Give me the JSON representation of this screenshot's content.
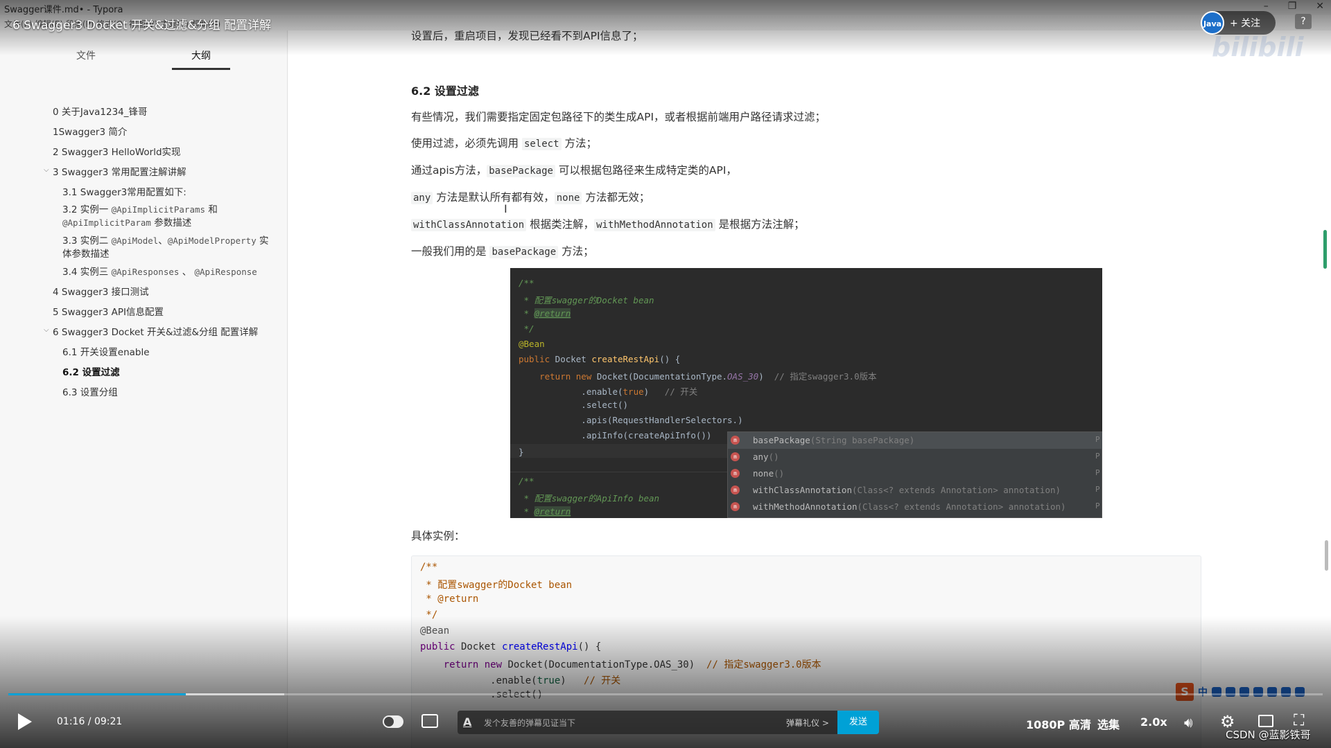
{
  "window": {
    "app_title": "Swagger课件.md• - Typora",
    "menu_stub": "文件(F)  编辑(E)  段落(P)  格式(O)  视图(V)  主题(T)  帮助(H)"
  },
  "sidebar": {
    "tab_files": "文件",
    "tab_outline": "大纲",
    "items": [
      {
        "label": "0 关于Java1234_锋哥"
      },
      {
        "label": "1Swagger3 简介"
      },
      {
        "label": "2 Swagger3 HelloWorld实现"
      },
      {
        "label": "3 Swagger3 常用配置注解讲解"
      },
      {
        "label": "3.1 Swagger3常用配置如下:"
      },
      {
        "label_a": "3.2 实例一 ",
        "code_a": "@ApiImplicitParams",
        "label_b": " 和",
        "code_b": "@ApiImplicitParam",
        "label_c": " 参数描述"
      },
      {
        "label_a": "3.3 实例二 ",
        "code_a": "@ApiModel",
        "label_b": "、",
        "code_b": "@ApiModelProperty",
        "label_c": " 实",
        "label_d": "体参数描述"
      },
      {
        "label_a": "3.4 实例三 ",
        "code_a": "@ApiResponses",
        "label_b": " 、 ",
        "code_b": "@ApiResponse"
      },
      {
        "label": "4 Swagger3 接口测试"
      },
      {
        "label": "5 Swagger3 API信息配置"
      },
      {
        "label": "6 Swagger3 Docket 开关&过滤&分组 配置详解"
      },
      {
        "label": "6.1 开关设置enable"
      },
      {
        "label": "6.2 设置过滤"
      },
      {
        "label": "6.3 设置分组"
      }
    ]
  },
  "content": {
    "p1": "设置后，重启项目，发现已经看不到API信息了；",
    "h3": "6.2 设置过滤",
    "p2": "有些情况，我们需要指定固定包路径下的类生成API，或者根据前端用户路径请求过滤；",
    "p3_a": "使用过滤，必须先调用 ",
    "p3_code": "select",
    "p3_b": " 方法；",
    "p4_a": "通过apis方法，",
    "p4_code": "basePackage",
    "p4_b": " 可以根据包路径来生成特定类的API，",
    "p5_code1": "any",
    "p5_a": " 方法是默认所有都有效，",
    "p5_code2": "none",
    "p5_b": " 方法都无效；",
    "p6_code1": "withClassAnnotation",
    "p6_a": " 根据类注解，",
    "p6_code2": "withMethodAnnotation",
    "p6_b": " 是根据方法注解；",
    "p7_a": "一般我们用的是 ",
    "p7_code": "basePackage",
    "p7_b": " 方法；",
    "p8": "具体实例：",
    "text_cursor": "I"
  },
  "ide": {
    "l1": "/**",
    "l2_a": " * 配置",
    "l2_b": "swagger的Docket bean",
    "l3_a": " * ",
    "l3_b": "@return",
    "l4": " */",
    "l5": "@Bean",
    "l6_kw": "public",
    "l6_type": " Docket ",
    "l6_fn": "createRestApi",
    "l6_rest": "() {",
    "l7_kw1": "    return new",
    "l7_a": " Docket(DocumentationType.",
    "l7_const": "OAS_30",
    "l7_b": ")  ",
    "l7_cmt": "// 指定swagger3.0版本",
    "l8_a": "            .enable(",
    "l8_bool": "true",
    "l8_b": ")   ",
    "l8_cmt": "// 开关",
    "l9": "            .select()",
    "l10": "            .apis(RequestHandlerSelectors.)",
    "l11": "            .apiInfo(createApiInfo())",
    "l12": "}",
    "l13": "/**",
    "l14_a": " * 配置",
    "l14_b": "swagger的ApiInfo bean",
    "l15_a": " * ",
    "l15_b": "@return",
    "popup": [
      {
        "name": "basePackage",
        "sig": "(String basePackage)",
        "trail": "P"
      },
      {
        "name": "any",
        "sig": "()",
        "trail": "P"
      },
      {
        "name": "none",
        "sig": "()",
        "trail": "P"
      },
      {
        "name": "withClassAnnotation",
        "sig": "(Class<? extends Annotation> annotation)",
        "trail": "P"
      },
      {
        "name": "withMethodAnnotation",
        "sig": "(Class<? extends Annotation> annotation)",
        "trail": "P"
      }
    ],
    "popup_icon": "m"
  },
  "code_block": {
    "l1": "/**",
    "l2": " * 配置swagger的Docket bean",
    "l3": " * @return",
    "l4": " */",
    "l5": "@Bean",
    "l6_kw": "public",
    "l6_type": " Docket ",
    "l6_fn": "createRestApi",
    "l6_rest": "() {",
    "l7_kw": "    return new",
    "l7_a": " Docket(DocumentationType.OAS_30)  ",
    "l7_cmt": "// 指定swagger3.0版本",
    "l8_a": "            .enable(",
    "l8_bool": "true",
    "l8_b": ")   ",
    "l8_cmt": "// 开关",
    "l9": "            .select()"
  },
  "player": {
    "video_title": "6 Swagger3 Docket 开关&过滤&分组 配置详解",
    "follow_label": "+ 关注",
    "avatar_text": "Java",
    "help": "?",
    "watermark": "bilibili",
    "time": "01:16 / 09:21",
    "progress_fraction": 0.135,
    "buffer_fraction": 0.21,
    "danmaku_placeholder": "发个友善的弹幕见证当下",
    "danmaku_etiquette": "弹幕礼仪 >",
    "send_label": "发送",
    "quality": "1080P 高清",
    "episodes": "选集",
    "speed": "2.0x",
    "csdn": "CSDN @蓝影铁哥",
    "ime_logo": "S",
    "ime_cn": "中"
  },
  "colors": {
    "accent": "#00a1d6",
    "ide_bg": "#2b2b2b",
    "scroll": "#2e9e6b"
  }
}
